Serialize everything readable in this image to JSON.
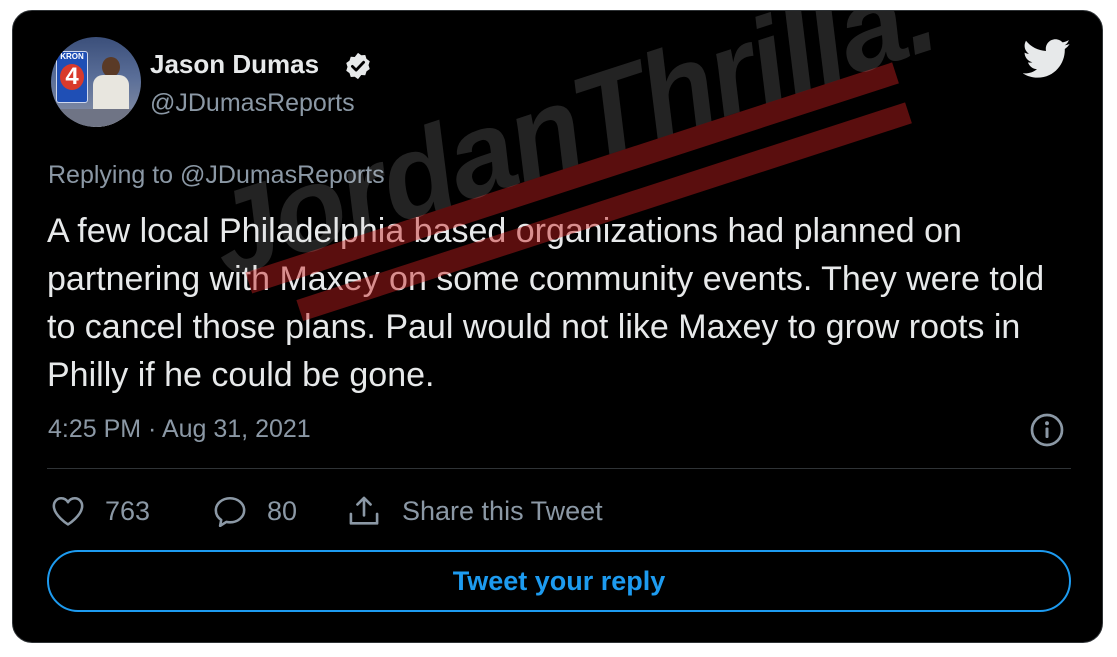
{
  "author": {
    "name": "Jason Dumas",
    "handle": "@JDumasReports",
    "verified": true,
    "avatar_badge": "KRON",
    "avatar_channel": "4"
  },
  "tweet": {
    "replying_to": "Replying to @JDumasReports",
    "text": "A few local Philadelphia based organizations had planned on partnering with Maxey on some community events. They were told to cancel those plans. Paul would not like Maxey to grow roots in Philly if he could be gone.",
    "timestamp": "4:25 PM · Aug 31, 2021"
  },
  "actions": {
    "likes": "763",
    "replies": "80",
    "share_label": "Share this Tweet"
  },
  "reply_button_label": "Tweet your reply",
  "watermark": "JordanThrilla.",
  "icons": {
    "brand": "twitter-bird-icon",
    "verified": "verified-badge-icon",
    "info": "info-icon",
    "like": "heart-icon",
    "reply": "comment-icon",
    "share": "share-icon"
  },
  "colors": {
    "background": "#000000",
    "text_primary": "#e7e9ea",
    "text_secondary": "#8b98a5",
    "accent": "#1d9bf0",
    "watermark_bar": "#c81e1e"
  }
}
